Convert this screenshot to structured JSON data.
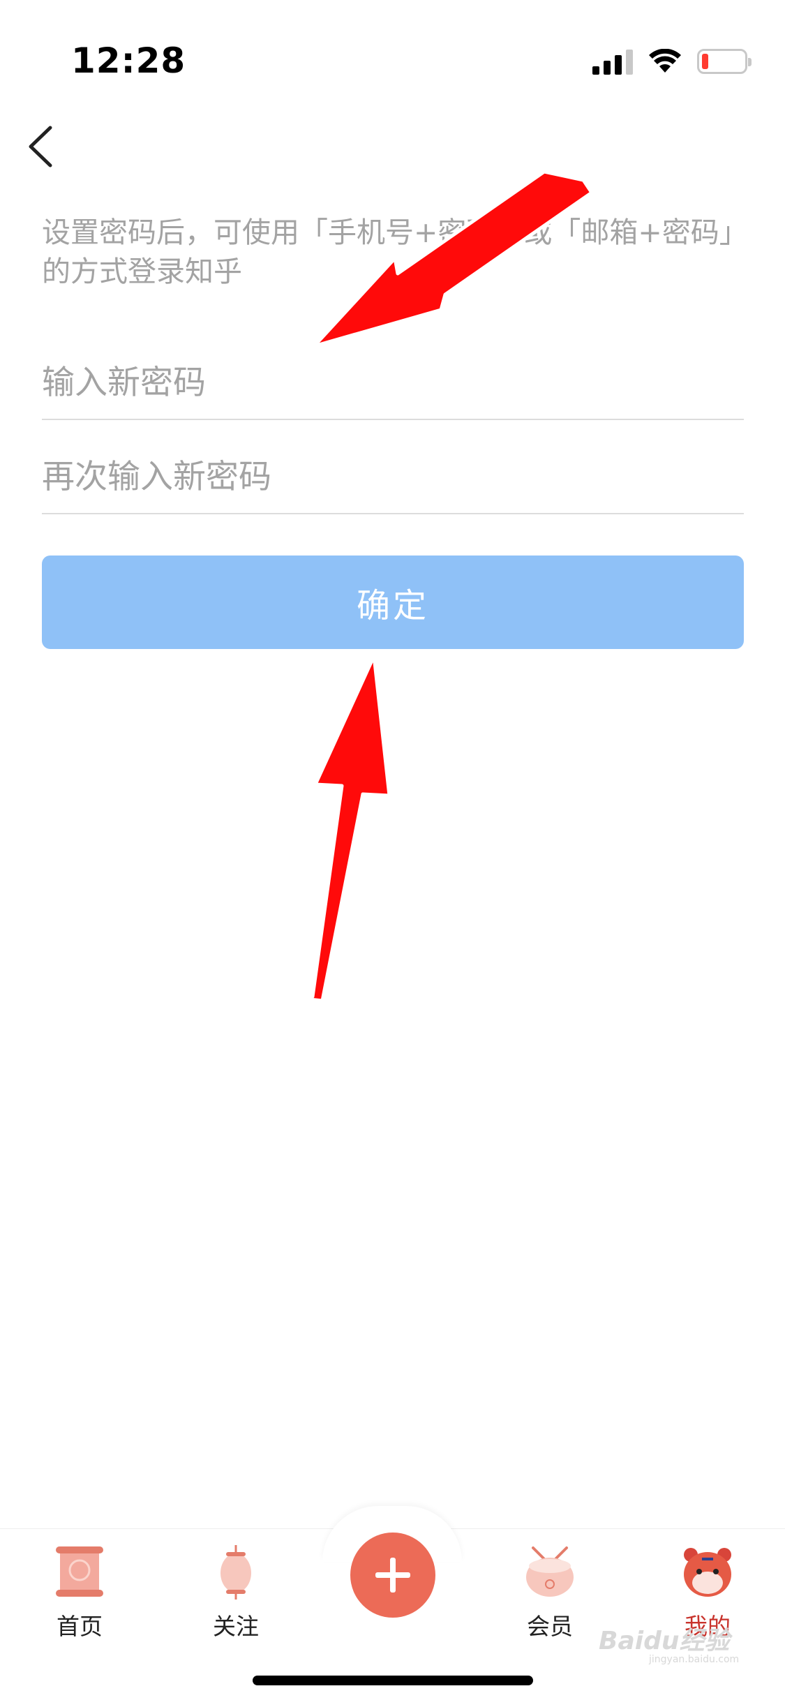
{
  "status_bar": {
    "time": "12:28",
    "battery_level": 0.1,
    "battery_color": "#ff3b30",
    "icons": [
      "signal-icon",
      "wifi-icon",
      "battery-icon"
    ]
  },
  "nav": {
    "back_icon": "chevron-left-icon"
  },
  "description": "设置密码后，可使用「手机号+密码」或「邮箱+密码」的方式登录知乎",
  "form": {
    "new_password_placeholder": "输入新密码",
    "confirm_password_placeholder": "再次输入新密码",
    "confirm_label": "确定",
    "confirm_color": "#8fc1f7"
  },
  "annotations": {
    "arrow_color": "#ff0000",
    "arrow_count": 2
  },
  "tab_bar": {
    "items": [
      {
        "label": "首页",
        "icon": "scroll-icon",
        "active": false
      },
      {
        "label": "关注",
        "icon": "lantern-icon",
        "active": false
      },
      {
        "label": "",
        "icon": "plus-icon",
        "active": false
      },
      {
        "label": "会员",
        "icon": "drum-icon",
        "active": false
      },
      {
        "label": "我的",
        "icon": "tiger-icon",
        "active": true
      }
    ],
    "active_color": "#c8332c",
    "add_button_color": "#ec6b57"
  },
  "watermark": {
    "text": "Baidu经验",
    "sub": "jingyan.baidu.com"
  }
}
